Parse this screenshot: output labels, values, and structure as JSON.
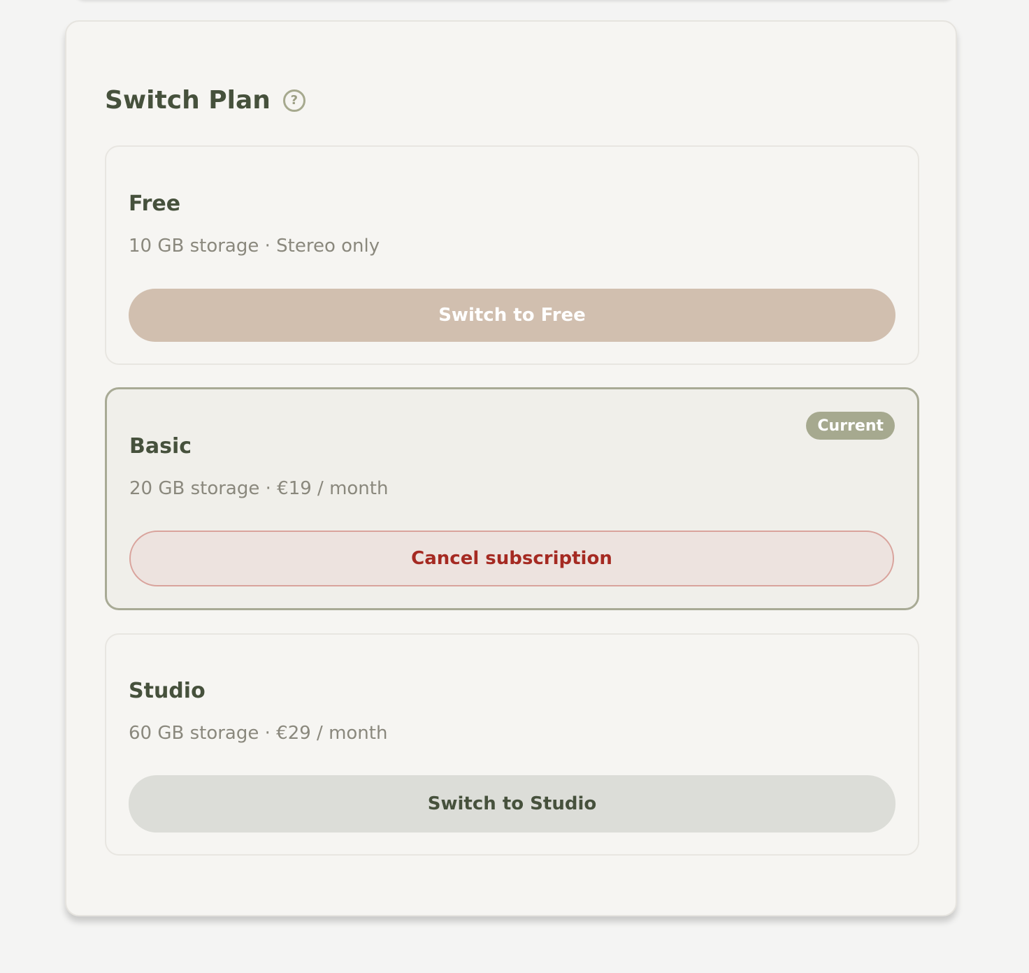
{
  "panel": {
    "title": "Switch Plan",
    "help_icon": "question-circle-icon",
    "help_glyph": "?"
  },
  "plans": [
    {
      "name": "Free",
      "description": "10 GB storage · Stereo only",
      "action_label": "Switch to Free",
      "current": false
    },
    {
      "name": "Basic",
      "description": "20 GB storage · €19 / month",
      "action_label": "Cancel subscription",
      "badge": "Current",
      "current": true
    },
    {
      "name": "Studio",
      "description": "60 GB storage · €29 / month",
      "action_label": "Switch to Studio",
      "current": false
    }
  ],
  "colors": {
    "title": "#46513c",
    "free_button": "#d1bfaf",
    "cancel_text": "#a52a22",
    "cancel_border": "#d9a39c",
    "badge": "#a6a98f",
    "studio_button": "#dcddd8"
  }
}
